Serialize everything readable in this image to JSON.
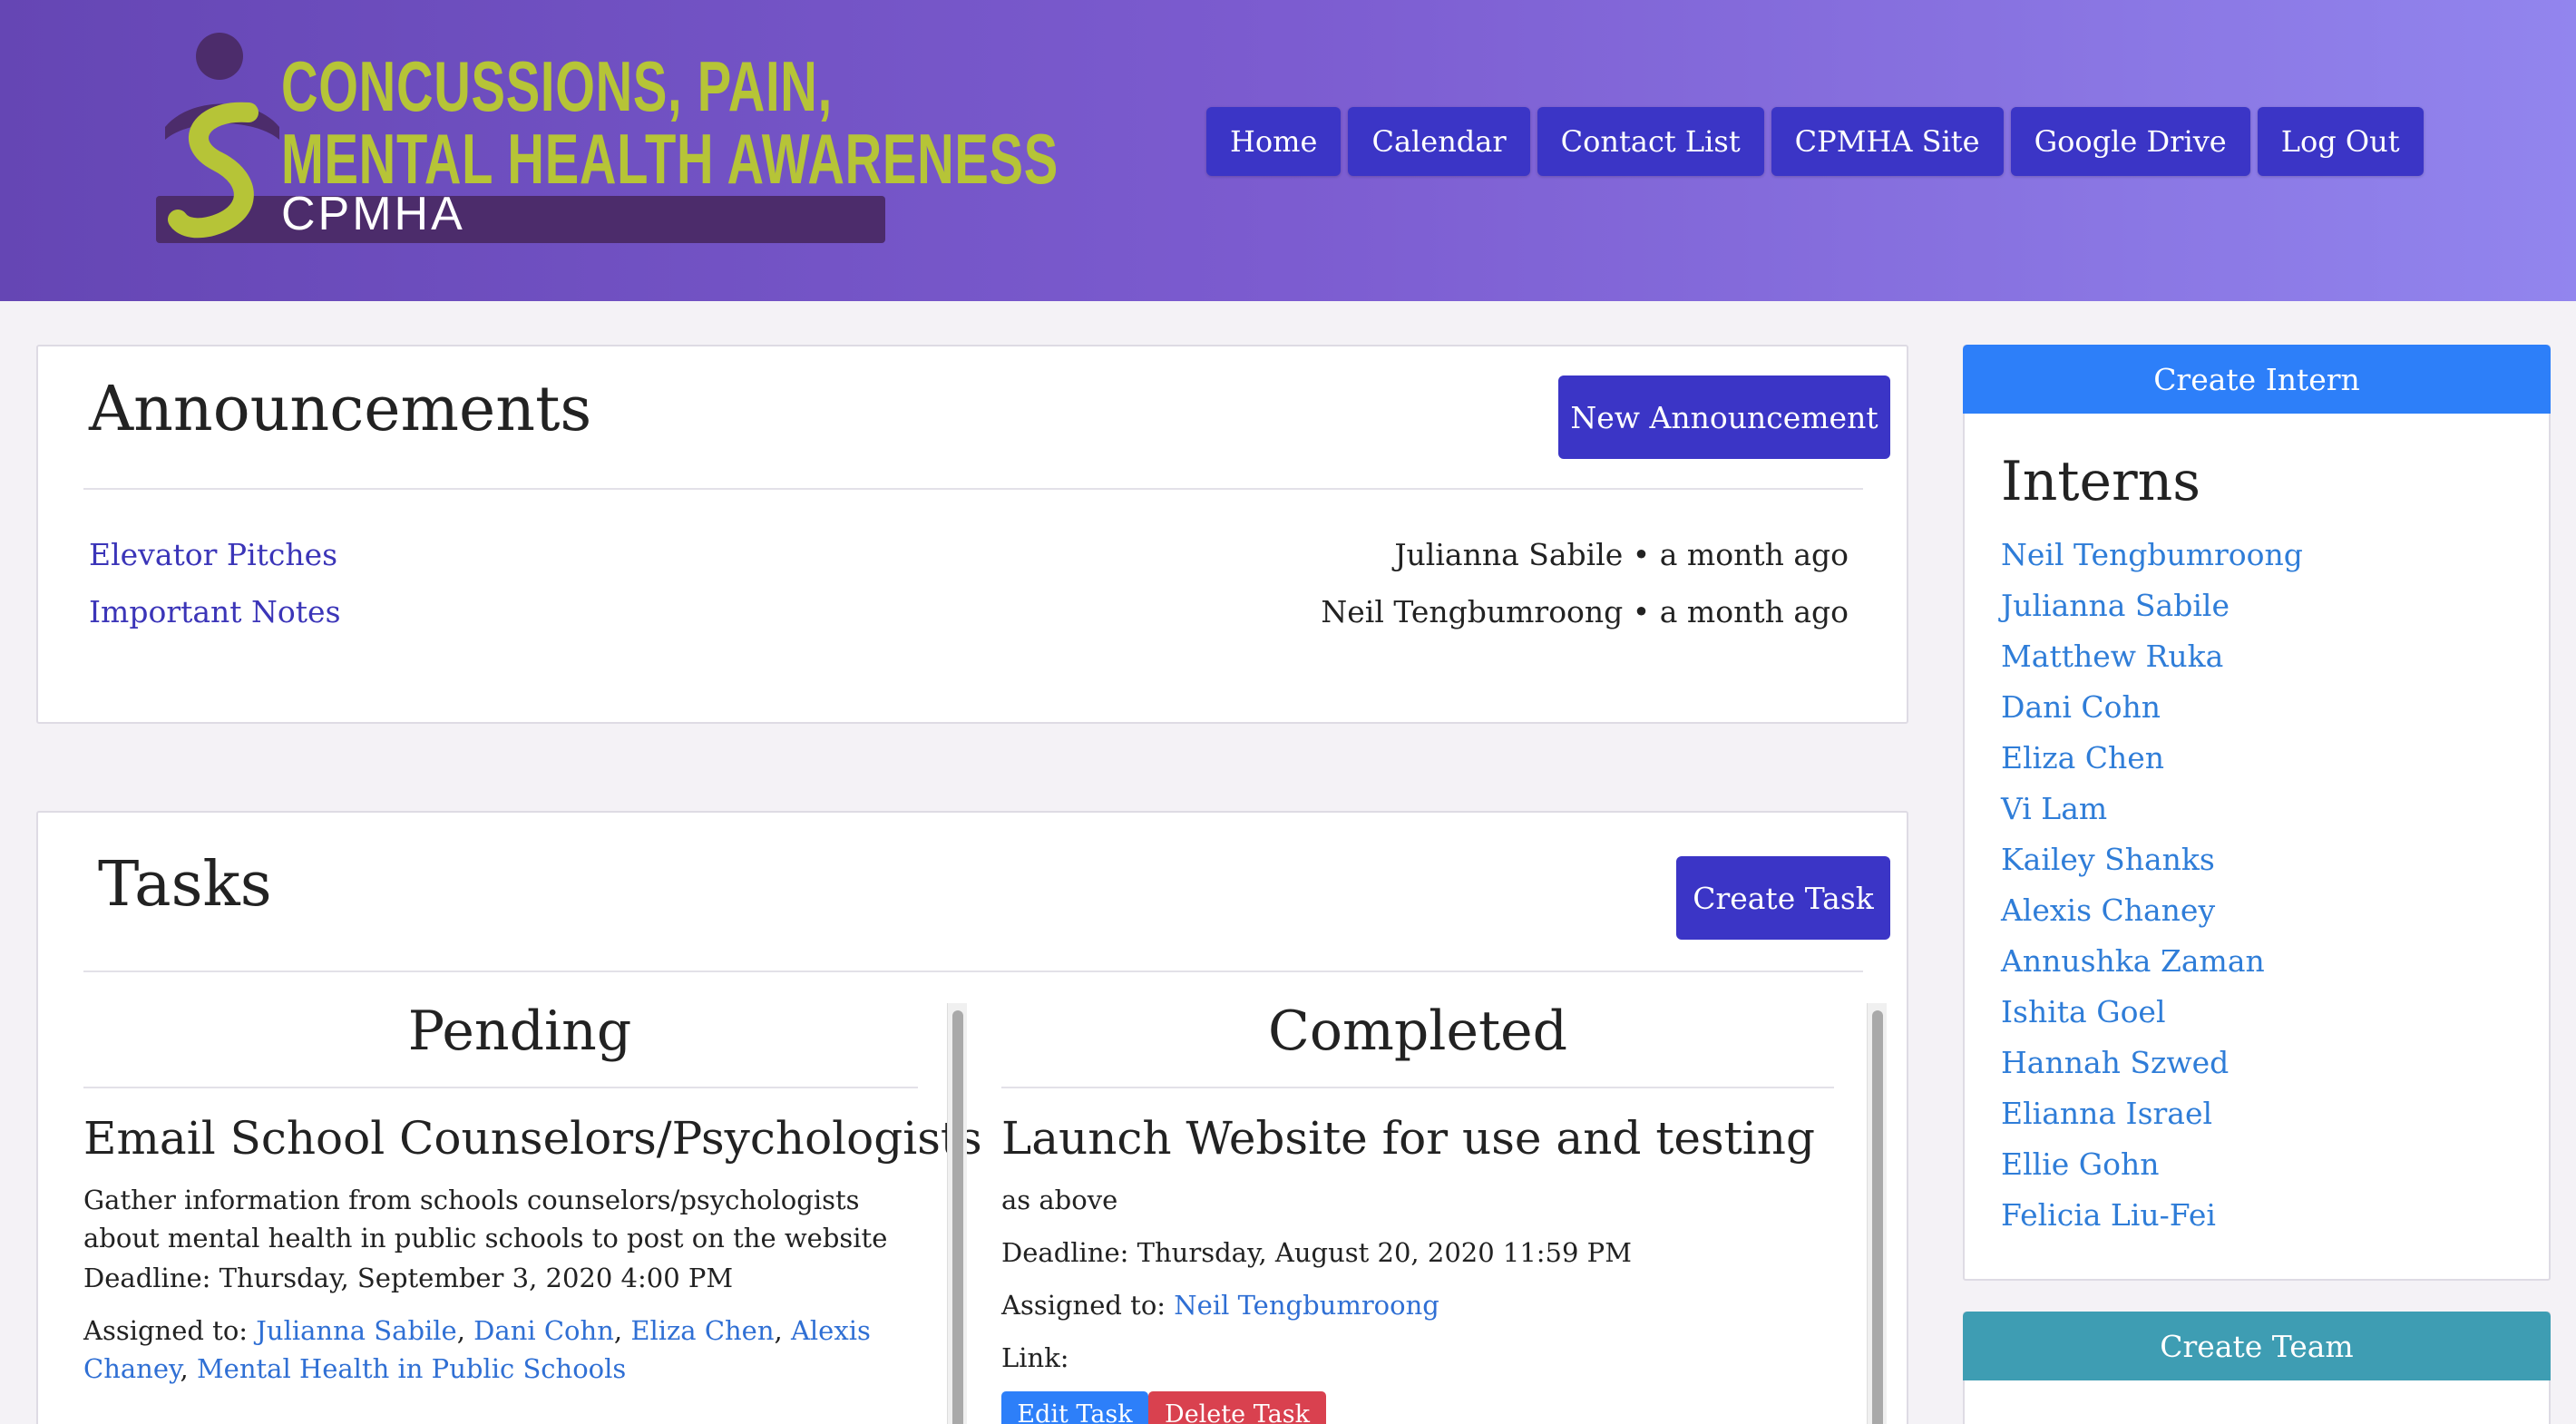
{
  "brand": {
    "logo_line1": "CONCUSSIONS, PAIN,",
    "logo_line2": "MENTAL HEALTH AWARENESS",
    "logo_acronym": "CPMHA"
  },
  "nav": [
    {
      "label": "Home"
    },
    {
      "label": "Calendar"
    },
    {
      "label": "Contact List"
    },
    {
      "label": "CPMHA Site"
    },
    {
      "label": "Google Drive"
    },
    {
      "label": "Log Out"
    }
  ],
  "announcements": {
    "title": "Announcements",
    "new_button": "New Announcement",
    "items": [
      {
        "title": "Elevator Pitches",
        "meta": "Julianna Sabile • a month ago"
      },
      {
        "title": "Important Notes",
        "meta": "Neil Tengbumroong • a month ago"
      }
    ]
  },
  "tasks": {
    "title": "Tasks",
    "create_button": "Create Task",
    "pending": {
      "heading": "Pending",
      "task": {
        "title": "Email School Counselors/Psychologists",
        "description": "Gather information from schools counselors/psychologists about mental health in public schools to post on the website",
        "deadline": "Deadline: Thursday, September 3, 2020 4:00 PM",
        "assigned_label": "Assigned to:",
        "assignees": [
          "Julianna Sabile",
          "Dani Cohn",
          "Eliza Chen",
          "Alexis Chaney",
          "Mental Health in Public Schools"
        ],
        "separator": ","
      }
    },
    "completed": {
      "heading": "Completed",
      "task": {
        "title": "Launch Website for use and testing",
        "description": "as above",
        "deadline": "Deadline: Thursday, August 20, 2020 11:59 PM",
        "assigned_label": "Assigned to:",
        "assignees": [
          "Neil Tengbumroong"
        ],
        "link_label": "Link:",
        "edit_button": "Edit Task",
        "delete_button": "Delete Task"
      }
    }
  },
  "sidebar": {
    "create_intern_button": "Create Intern",
    "interns_title": "Interns",
    "interns": [
      "Neil Tengbumroong",
      "Julianna Sabile",
      "Matthew Ruka",
      "Dani Cohn",
      "Eliza Chen",
      "Vi Lam",
      "Kailey Shanks",
      "Alexis Chaney",
      "Annushka Zaman",
      "Ishita Goel",
      "Hannah Szwed",
      "Elianna Israel",
      "Ellie Gohn",
      "Felicia Liu-Fei"
    ],
    "create_team_button": "Create Team"
  },
  "colors": {
    "header_start": "#6546b4",
    "header_end": "#9285ee",
    "nav_button": "#3b35c6",
    "create_intern": "#2d7ff9",
    "create_team": "#3e9db3",
    "edit_task": "#2d7ff9",
    "delete_task": "#d9414f",
    "link": "#2f7dd8"
  }
}
